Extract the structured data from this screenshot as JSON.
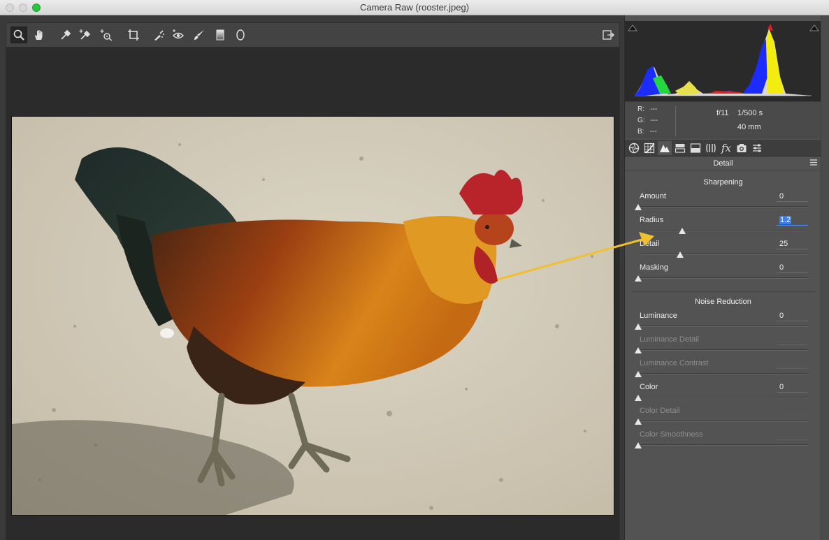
{
  "window": {
    "title": "Camera Raw (rooster.jpeg)"
  },
  "toolbar": {
    "tools": [
      {
        "name": "zoom-tool",
        "icon": "magnifier-icon"
      },
      {
        "name": "hand-tool",
        "icon": "hand-icon"
      },
      {
        "name": "white-balance-tool",
        "icon": "eyedropper-icon"
      },
      {
        "name": "color-sampler-tool",
        "icon": "eyedropper-plus-icon"
      },
      {
        "name": "targeted-adjustment-tool",
        "icon": "target-icon"
      },
      {
        "name": "crop-tool",
        "icon": "crop-icon"
      },
      {
        "name": "spot-removal-tool",
        "icon": "brush-heal-icon"
      },
      {
        "name": "red-eye-tool",
        "icon": "eye-icon"
      },
      {
        "name": "adjustment-brush-tool",
        "icon": "brush-icon"
      },
      {
        "name": "graduated-filter-tool",
        "icon": "gradient-icon"
      },
      {
        "name": "radial-filter-tool",
        "icon": "ellipse-icon"
      }
    ]
  },
  "readout": {
    "r_label": "R:",
    "r_value": "---",
    "g_label": "G:",
    "g_value": "---",
    "b_label": "B:",
    "b_value": "---",
    "aperture": "f/11",
    "shutter": "1/500 s",
    "focal_length": "40 mm"
  },
  "panel": {
    "title": "Detail",
    "sharpening": {
      "heading": "Sharpening",
      "sliders": [
        {
          "label": "Amount",
          "value": "0",
          "fraction": 0.0,
          "enabled": true
        },
        {
          "label": "Radius",
          "value": "1.2",
          "fraction": 0.26,
          "enabled": true,
          "selected": true
        },
        {
          "label": "Detail",
          "value": "25",
          "fraction": 0.25,
          "enabled": true
        },
        {
          "label": "Masking",
          "value": "0",
          "fraction": 0.0,
          "enabled": true
        }
      ]
    },
    "noise": {
      "heading": "Noise Reduction",
      "sliders": [
        {
          "label": "Luminance",
          "value": "0",
          "fraction": 0.0,
          "enabled": true
        },
        {
          "label": "Luminance Detail",
          "value": "",
          "fraction": 0.0,
          "enabled": false
        },
        {
          "label": "Luminance Contrast",
          "value": "",
          "fraction": 0.0,
          "enabled": false
        },
        {
          "label": "Color",
          "value": "0",
          "fraction": 0.0,
          "enabled": true
        },
        {
          "label": "Color Detail",
          "value": "",
          "fraction": 0.0,
          "enabled": false
        },
        {
          "label": "Color Smoothness",
          "value": "",
          "fraction": 0.0,
          "enabled": false
        }
      ]
    }
  },
  "colors": {
    "accent": "#3e7de0",
    "arrow": "#f0c030"
  }
}
